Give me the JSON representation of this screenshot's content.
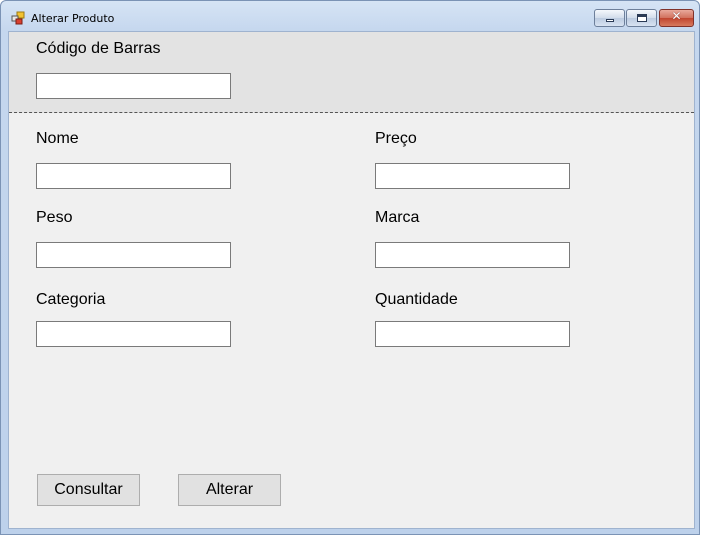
{
  "window": {
    "title": "Alterar Produto",
    "icon": "app-icon"
  },
  "title_controls": {
    "minimize_icon": "minimize-icon",
    "maximize_icon": "maximize-icon",
    "close_icon": "close-icon",
    "close_glyph": "✕"
  },
  "form": {
    "barcode": {
      "label": "Código de Barras",
      "value": ""
    },
    "nome": {
      "label": "Nome",
      "value": ""
    },
    "preco": {
      "label": "Preço",
      "value": ""
    },
    "peso": {
      "label": "Peso",
      "value": ""
    },
    "marca": {
      "label": "Marca",
      "value": ""
    },
    "categoria": {
      "label": "Categoria",
      "value": ""
    },
    "quantidade": {
      "label": "Quantidade",
      "value": ""
    }
  },
  "buttons": {
    "consultar": "Consultar",
    "alterar": "Alterar"
  },
  "colors": {
    "form_background": "#f0f0f0",
    "top_panel_background": "#e3e3e3",
    "button_background": "#e1e1e1"
  }
}
